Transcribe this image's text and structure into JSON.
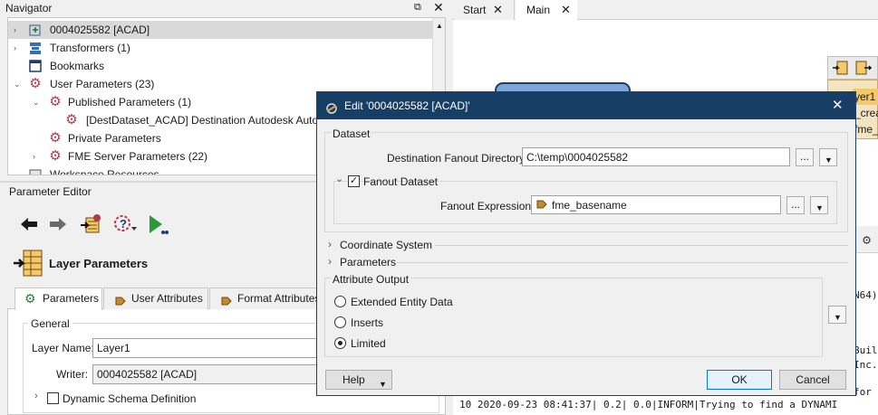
{
  "navigator": {
    "title": "Navigator",
    "items": [
      {
        "label": "0004025582 [ACAD]"
      },
      {
        "label": "Transformers (1)"
      },
      {
        "label": "Bookmarks"
      },
      {
        "label": "User Parameters (23)"
      },
      {
        "label": "Published Parameters (1)"
      },
      {
        "label": "[DestDataset_ACAD] Destination Autodesk AutoC"
      },
      {
        "label": "Private Parameters"
      },
      {
        "label": "FME Server Parameters (22)"
      },
      {
        "label": "Workspace Resources"
      }
    ]
  },
  "param_editor": {
    "title": "Parameter Editor",
    "heading": "Layer Parameters",
    "tabs": [
      "Parameters",
      "User Attributes",
      "Format Attributes"
    ],
    "group_label": "General",
    "layer_name_label": "Layer Name:",
    "layer_name_value": "Layer1",
    "writer_label": "Writer:",
    "writer_value": "0004025582 [ACAD]",
    "dynamic_schema_label": "Dynamic Schema Definition"
  },
  "canvas": {
    "tabs": [
      "Start",
      "Main"
    ],
    "node_text": [
      "yer1",
      "_crea",
      "fme_b"
    ],
    "log_partial": [
      "N64)",
      "Build",
      "Inc.",
      "for"
    ],
    "log_line": "10  2020-09-23 08:41:37|   0.2|  0.0|INFORM|Trying to find a DYNAMI"
  },
  "dialog": {
    "title": "Edit '0004025582 [ACAD]'",
    "dataset_section": "Dataset",
    "dest_dir_label": "Destination Fanout Directory:",
    "dest_dir_value": "C:\\temp\\0004025582",
    "fanout_dataset_label": "Fanout Dataset",
    "fanout_expr_label": "Fanout Expression:",
    "fanout_expr_value": "fme_basename",
    "coord_system": "Coordinate System",
    "parameters": "Parameters",
    "attribute_output": "Attribute Output",
    "options": [
      "Extended Entity Data",
      "Inserts",
      "Limited"
    ],
    "selected_option": "Limited",
    "help_label": "Help",
    "ok_label": "OK",
    "cancel_label": "Cancel",
    "ellipsis": "..."
  },
  "colors": {
    "dialog_title_bg": "#173f65",
    "selected_row": "#d9d9d9",
    "gear": "#b23a48"
  }
}
